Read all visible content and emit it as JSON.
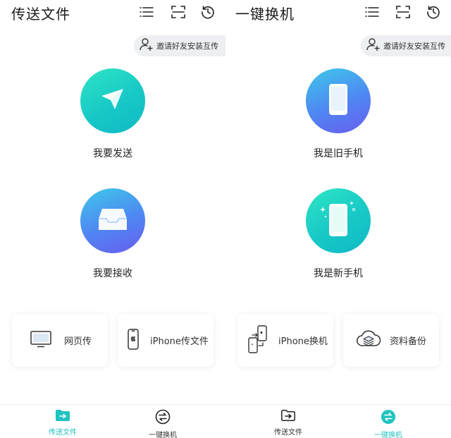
{
  "colors": {
    "accent": "#20c3bf",
    "teal_gradient": [
      "#2fe6c5",
      "#10b9c4"
    ],
    "blue_gradient": [
      "#3ec9ea",
      "#6a5cf0"
    ]
  },
  "left": {
    "title": "传送文件",
    "invite_label": "邀请好友安装互传",
    "send_label": "我要发送",
    "receive_label": "我要接收",
    "cards": [
      {
        "label": "网页传",
        "icon": "monitor-icon"
      },
      {
        "label": "iPhone传文件",
        "icon": "iphone-icon"
      }
    ]
  },
  "right": {
    "title": "一键换机",
    "invite_label": "邀请好友安装互传",
    "old_phone_label": "我是旧手机",
    "new_phone_label": "我是新手机",
    "cards": [
      {
        "label": "iPhone换机",
        "icon": "phone-swap-icon"
      },
      {
        "label": "资料备份",
        "icon": "cloud-backup-icon"
      }
    ]
  },
  "tabs": [
    {
      "label": "传送文件",
      "icon": "folder-icon"
    },
    {
      "label": "一键换机",
      "icon": "swap-icon"
    }
  ],
  "left_active_tab": "传送文件",
  "right_active_tab": "一键换机"
}
